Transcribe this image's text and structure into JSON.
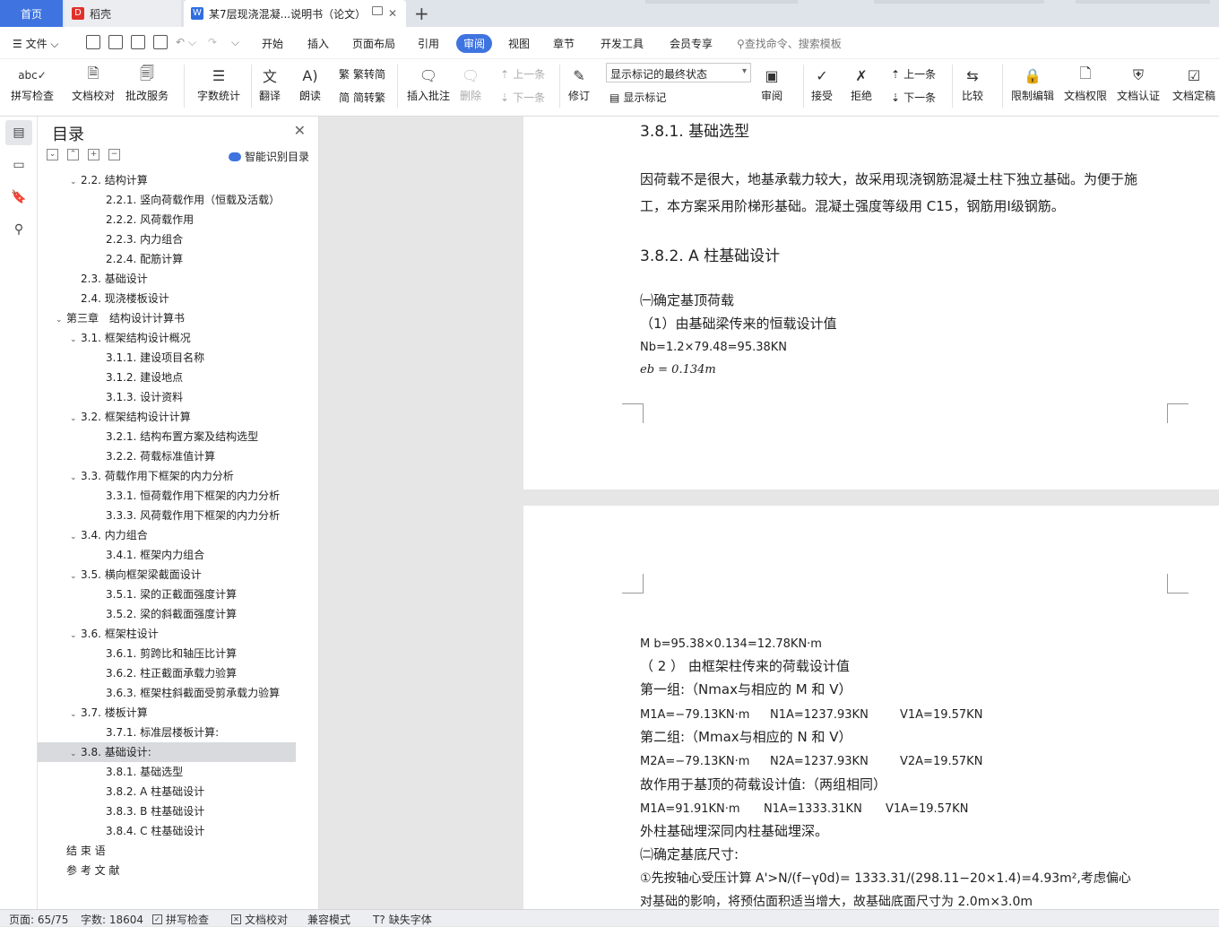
{
  "tabs": {
    "home": "首页",
    "daoke": "稻壳",
    "doc": "某7层现浇混凝...说明书（论文）"
  },
  "menu": {
    "file": "文件",
    "items": [
      "开始",
      "插入",
      "页面布局",
      "引用",
      "审阅",
      "视图",
      "章节",
      "开发工具",
      "会员专享"
    ],
    "active": "审阅",
    "search": "查找命令、搜索模板"
  },
  "ribbon": {
    "spell": "拼写检查",
    "proof": "文档校对",
    "batch": "批改服务",
    "wordcount": "字数统计",
    "translate": "翻译",
    "read": "朗读",
    "trad": "繁转简",
    "simp": "简转繁",
    "insert_comment": "插入批注",
    "delete": "删除",
    "prev1": "上一条",
    "next1": "下一条",
    "revise": "修订",
    "markup_state": "显示标记的最终状态",
    "show_markup": "显示标记",
    "review": "审阅",
    "accept": "接受",
    "reject": "拒绝",
    "prev2": "上一条",
    "next2": "下一条",
    "compare": "比较",
    "restrict": "限制编辑",
    "perm": "文档权限",
    "cert": "文档认证",
    "final": "文档定稿"
  },
  "toc": {
    "title": "目录",
    "smart": "智能识别目录",
    "items": [
      {
        "t": "2.2. 结构计算",
        "lvl": 2,
        "exp": true
      },
      {
        "t": "2.2.1. 竖向荷载作用（恒载及活载）",
        "lvl": 3
      },
      {
        "t": "2.2.2. 风荷载作用",
        "lvl": 3
      },
      {
        "t": "2.2.3. 内力组合",
        "lvl": 3
      },
      {
        "t": "2.2.4. 配筋计算",
        "lvl": 3
      },
      {
        "t": "2.3. 基础设计",
        "lvl": 2
      },
      {
        "t": "2.4. 现浇楼板设计",
        "lvl": 2
      },
      {
        "t": "第三章　结构设计计算书",
        "lvl": 1,
        "exp": true
      },
      {
        "t": "3.1. 框架结构设计概况",
        "lvl": 2,
        "exp": true
      },
      {
        "t": "3.1.1. 建设项目名称",
        "lvl": 3
      },
      {
        "t": "3.1.2. 建设地点",
        "lvl": 3
      },
      {
        "t": "3.1.3. 设计资料",
        "lvl": 3
      },
      {
        "t": "3.2. 框架结构设计计算",
        "lvl": 2,
        "exp": true
      },
      {
        "t": "3.2.1. 结构布置方案及结构选型",
        "lvl": 3
      },
      {
        "t": "3.2.2. 荷载标准值计算",
        "lvl": 3
      },
      {
        "t": "3.3. 荷载作用下框架的内力分析",
        "lvl": 2,
        "exp": true
      },
      {
        "t": "3.3.1. 恒荷载作用下框架的内力分析",
        "lvl": 3
      },
      {
        "t": "3.3.3. 风荷载作用下框架的内力分析",
        "lvl": 3
      },
      {
        "t": "3.4. 内力组合",
        "lvl": 2,
        "exp": true
      },
      {
        "t": "3.4.1. 框架内力组合",
        "lvl": 3
      },
      {
        "t": "3.5. 横向框架梁截面设计",
        "lvl": 2,
        "exp": true
      },
      {
        "t": "3.5.1. 梁的正截面强度计算",
        "lvl": 3
      },
      {
        "t": "3.5.2. 梁的斜截面强度计算",
        "lvl": 3
      },
      {
        "t": "3.6. 框架柱设计",
        "lvl": 2,
        "exp": true
      },
      {
        "t": "3.6.1. 剪跨比和轴压比计算",
        "lvl": 3
      },
      {
        "t": "3.6.2. 柱正截面承载力验算",
        "lvl": 3
      },
      {
        "t": "3.6.3. 框架柱斜截面受剪承载力验算",
        "lvl": 3
      },
      {
        "t": "3.7. 楼板计算",
        "lvl": 2,
        "exp": true
      },
      {
        "t": "3.7.1. 标准层楼板计算:",
        "lvl": 3
      },
      {
        "t": "3.8. 基础设计:",
        "lvl": 2,
        "exp": true,
        "selected": true
      },
      {
        "t": "3.8.1. 基础选型",
        "lvl": 3
      },
      {
        "t": "3.8.2. A 柱基础设计",
        "lvl": 3
      },
      {
        "t": "3.8.3. B 柱基础设计",
        "lvl": 3
      },
      {
        "t": "3.8.4. C 柱基础设计",
        "lvl": 3
      },
      {
        "t": "结 束 语",
        "lvl": 1
      },
      {
        "t": "参 考 文 献",
        "lvl": 1
      }
    ]
  },
  "doc": {
    "h381": "3.8.1.  基础选型",
    "para1a": "因荷载不是很大，地基承载力较大，故采用现浇钢筋混凝土柱下独立基础。为便于施",
    "para1b": "工，本方案采用阶梯形基础。混凝土强度等级用 C15，钢筋用Ⅰ级钢筋。",
    "h382": "3.8.2.  A 柱基础设计",
    "s1": "㈠确定基顶荷载",
    "s2": "（1）由基础梁传来的恒载设计值",
    "nb": "Nb=1.2×79.48=95.38KN",
    "eb": "eb = 0.134m",
    "mb": "M b=95.38×0.134=12.78KN·m",
    "s3": "（ 2 ） 由框架柱传来的荷载设计值",
    "g1": "第一组:（Nmax与相应的 M 和 V）",
    "g1v": [
      "M1A=−79.13KN·m",
      "N1A=1237.93KN",
      "V1A=19.57KN"
    ],
    "g2": "第二组:（Mmax与相应的 N 和 V）",
    "g2v": [
      "M2A=−79.13KN·m",
      "N2A=1237.93KN",
      "V2A=19.57KN"
    ],
    "g3": "故作用于基顶的荷载设计值:（两组相同）",
    "g3v": [
      "M1A=91.91KN·m",
      "N1A=1333.31KN",
      "V1A=19.57KN"
    ],
    "s4": "外柱基础埋深同内柱基础埋深。",
    "s5": "㈡确定基底尺寸:",
    "s6": "①先按轴心受压计算 A'>N/(f−γ0d)= 1333.31/(298.11−20×1.4)=4.93m²,考虑偏心",
    "s7": "对基础的影响，将预估面积适当增大，故基础底面尺寸为 2.0m×3.0m"
  },
  "status": {
    "page": "页面: 65/75",
    "words": "字数: 18604",
    "spell": "拼写检查",
    "proof": "文档校对",
    "compat": "兼容模式",
    "missing_font": "缺失字体"
  }
}
